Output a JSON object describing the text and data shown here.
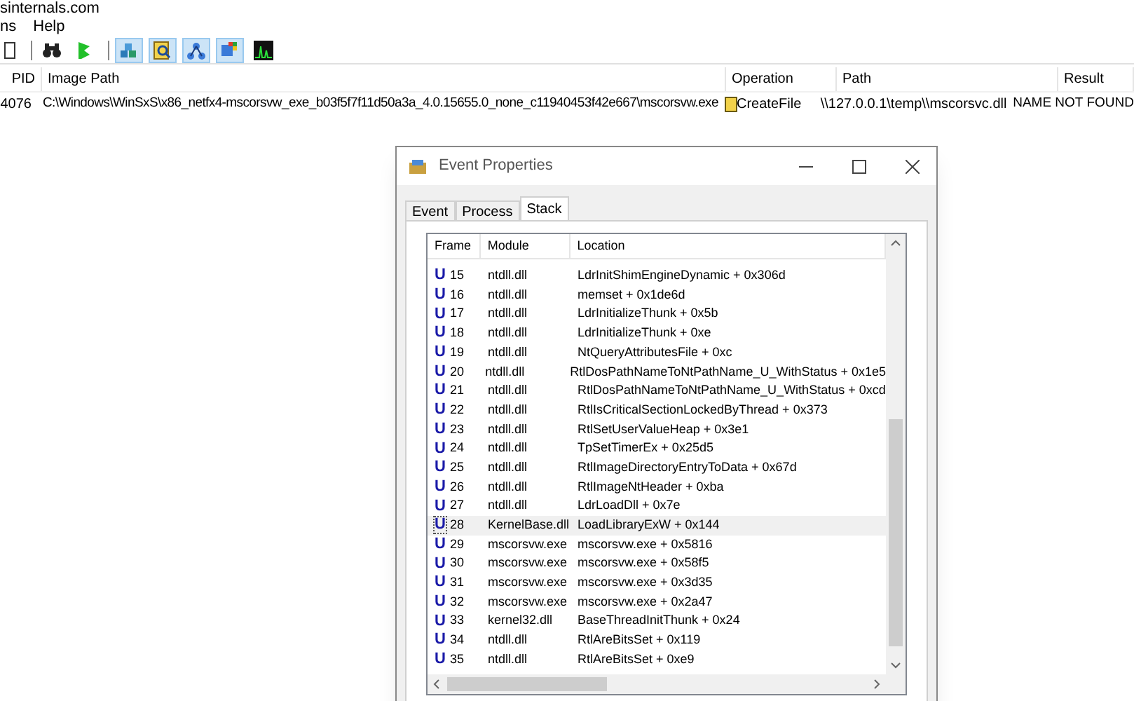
{
  "window": {
    "title": "sinternals.com"
  },
  "menu": [
    "ns",
    "Help"
  ],
  "toolbar": [
    {
      "kind": "page",
      "pressed": false
    },
    {
      "kind": "find",
      "pressed": false
    },
    {
      "kind": "jump",
      "pressed": false
    },
    {
      "kind": "registry",
      "pressed": true
    },
    {
      "kind": "filesystem",
      "pressed": true
    },
    {
      "kind": "network",
      "pressed": true
    },
    {
      "kind": "process",
      "pressed": true
    },
    {
      "kind": "profiling",
      "pressed": false
    }
  ],
  "table": {
    "columns": [
      "PID",
      "Image Path",
      "Operation",
      "Path",
      "Result"
    ],
    "rows": [
      {
        "pid": "4076",
        "image_path": "C:\\Windows\\WinSxS\\x86_netfx4-mscorsvw_exe_b03f5f7f11d50a3a_4.0.15655.0_none_c11940453f42e667\\mscorsvw.exe",
        "operation": "CreateFile",
        "path": "\\\\127.0.0.1\\temp\\\\mscorsvc.dll",
        "result": "NAME NOT FOUND"
      }
    ]
  },
  "dialog": {
    "title": "Event Properties",
    "tabs": [
      {
        "label": "Event",
        "selected": false
      },
      {
        "label": "Process",
        "selected": false
      },
      {
        "label": "Stack",
        "selected": true
      }
    ],
    "stack": {
      "columns": [
        "Frame",
        "Module",
        "Location"
      ],
      "rows": [
        {
          "mode": "U",
          "frame": "15",
          "module": "ntdll.dll",
          "location": "LdrInitShimEngineDynamic + 0x306d",
          "selected": false
        },
        {
          "mode": "U",
          "frame": "16",
          "module": "ntdll.dll",
          "location": "memset + 0x1de6d",
          "selected": false
        },
        {
          "mode": "U",
          "frame": "17",
          "module": "ntdll.dll",
          "location": "LdrInitializeThunk + 0x5b",
          "selected": false
        },
        {
          "mode": "U",
          "frame": "18",
          "module": "ntdll.dll",
          "location": "LdrInitializeThunk + 0xe",
          "selected": false
        },
        {
          "mode": "U",
          "frame": "19",
          "module": "ntdll.dll",
          "location": "NtQueryAttributesFile + 0xc",
          "selected": false
        },
        {
          "mode": "U",
          "frame": "20",
          "module": "ntdll.dll",
          "location": "RtlDosPathNameToNtPathName_U_WithStatus + 0x1e5",
          "selected": false
        },
        {
          "mode": "U",
          "frame": "21",
          "module": "ntdll.dll",
          "location": "RtlDosPathNameToNtPathName_U_WithStatus + 0xcd",
          "selected": false
        },
        {
          "mode": "U",
          "frame": "22",
          "module": "ntdll.dll",
          "location": "RtlIsCriticalSectionLockedByThread + 0x373",
          "selected": false
        },
        {
          "mode": "U",
          "frame": "23",
          "module": "ntdll.dll",
          "location": "RtlSetUserValueHeap + 0x3e1",
          "selected": false
        },
        {
          "mode": "U",
          "frame": "24",
          "module": "ntdll.dll",
          "location": "TpSetTimerEx + 0x25d5",
          "selected": false
        },
        {
          "mode": "U",
          "frame": "25",
          "module": "ntdll.dll",
          "location": "RtlImageDirectoryEntryToData + 0x67d",
          "selected": false
        },
        {
          "mode": "U",
          "frame": "26",
          "module": "ntdll.dll",
          "location": "RtlImageNtHeader + 0xba",
          "selected": false
        },
        {
          "mode": "U",
          "frame": "27",
          "module": "ntdll.dll",
          "location": "LdrLoadDll + 0x7e",
          "selected": false
        },
        {
          "mode": "U",
          "frame": "28",
          "module": "KernelBase.dll",
          "location": "LoadLibraryExW + 0x144",
          "selected": true
        },
        {
          "mode": "U",
          "frame": "29",
          "module": "mscorsvw.exe",
          "location": "mscorsvw.exe + 0x5816",
          "selected": false
        },
        {
          "mode": "U",
          "frame": "30",
          "module": "mscorsvw.exe",
          "location": "mscorsvw.exe + 0x58f5",
          "selected": false
        },
        {
          "mode": "U",
          "frame": "31",
          "module": "mscorsvw.exe",
          "location": "mscorsvw.exe + 0x3d35",
          "selected": false
        },
        {
          "mode": "U",
          "frame": "32",
          "module": "mscorsvw.exe",
          "location": "mscorsvw.exe + 0x2a47",
          "selected": false
        },
        {
          "mode": "U",
          "frame": "33",
          "module": "kernel32.dll",
          "location": "BaseThreadInitThunk + 0x24",
          "selected": false
        },
        {
          "mode": "U",
          "frame": "34",
          "module": "ntdll.dll",
          "location": "RtlAreBitsSet + 0x119",
          "selected": false
        },
        {
          "mode": "U",
          "frame": "35",
          "module": "ntdll.dll",
          "location": "RtlAreBitsSet + 0xe9",
          "selected": false
        }
      ]
    }
  }
}
